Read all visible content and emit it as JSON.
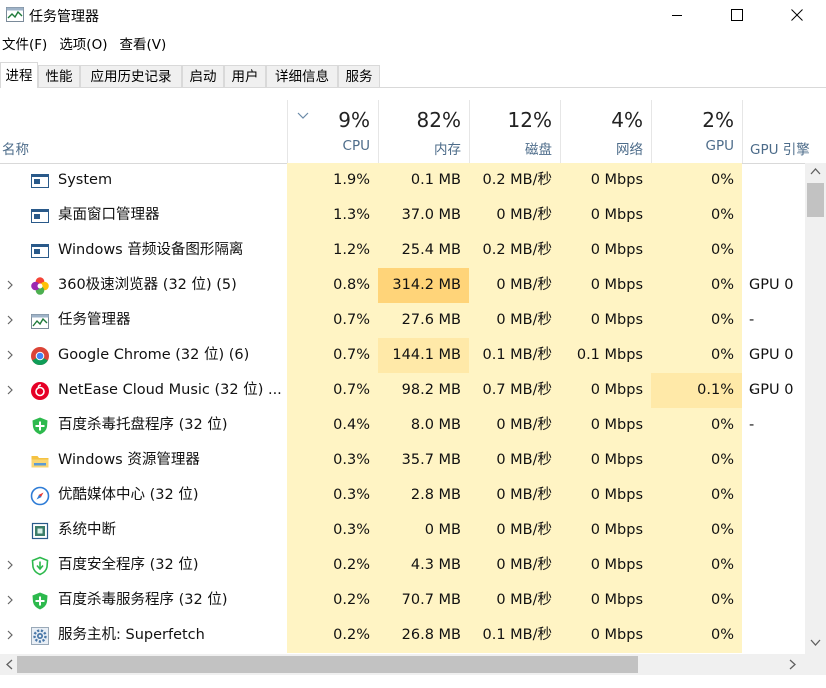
{
  "window": {
    "title": "任务管理器"
  },
  "menu": [
    "文件(F)",
    "选项(O)",
    "查看(V)"
  ],
  "tabs": [
    "进程",
    "性能",
    "应用历史记录",
    "启动",
    "用户",
    "详细信息",
    "服务"
  ],
  "columns": {
    "name_label": "名称",
    "cpu": {
      "pct": "9%",
      "label": "CPU"
    },
    "mem": {
      "pct": "82%",
      "label": "内存"
    },
    "disk": {
      "pct": "12%",
      "label": "磁盘"
    },
    "net": {
      "pct": "4%",
      "label": "网络"
    },
    "gpu": {
      "pct": "2%",
      "label": "GPU"
    },
    "engine_label": "GPU 引擎"
  },
  "colors": {
    "heat_light": "#fff4c4",
    "heat_mid": "#ffe9a8",
    "heat_hot": "#ffd479",
    "accent_text": "#4d6c8a"
  },
  "processes": [
    {
      "name": "System",
      "icon": "window-app-icon",
      "expandable": false,
      "cpu": "1.9%",
      "mem": "0.1 MB",
      "disk": "0.2 MB/秒",
      "net": "0 Mbps",
      "gpu": "0%",
      "engine": ""
    },
    {
      "name": "桌面窗口管理器",
      "icon": "window-app-icon",
      "expandable": false,
      "cpu": "1.3%",
      "mem": "37.0 MB",
      "disk": "0 MB/秒",
      "net": "0 Mbps",
      "gpu": "0%",
      "engine": ""
    },
    {
      "name": "Windows 音频设备图形隔离",
      "icon": "window-app-icon",
      "expandable": false,
      "cpu": "1.2%",
      "mem": "25.4 MB",
      "disk": "0.2 MB/秒",
      "net": "0 Mbps",
      "gpu": "0%",
      "engine": ""
    },
    {
      "name": "360极速浏览器 (32 位) (5)",
      "icon": "360-browser-icon",
      "expandable": true,
      "cpu": "0.8%",
      "mem": "314.2 MB",
      "disk": "0 MB/秒",
      "net": "0 Mbps",
      "gpu": "0%",
      "engine": "GPU 0 -"
    },
    {
      "name": "任务管理器",
      "icon": "task-manager-icon",
      "expandable": true,
      "cpu": "0.7%",
      "mem": "27.6 MB",
      "disk": "0 MB/秒",
      "net": "0 Mbps",
      "gpu": "0%",
      "engine": ""
    },
    {
      "name": "Google Chrome (32 位) (6)",
      "icon": "chrome-icon",
      "expandable": true,
      "cpu": "0.7%",
      "mem": "144.1 MB",
      "disk": "0.1 MB/秒",
      "net": "0.1 Mbps",
      "gpu": "0%",
      "engine": "GPU 0 -"
    },
    {
      "name": "NetEase Cloud Music (32 位) ...",
      "icon": "netease-music-icon",
      "expandable": true,
      "cpu": "0.7%",
      "mem": "98.2 MB",
      "disk": "0.7 MB/秒",
      "net": "0 Mbps",
      "gpu": "0.1%",
      "engine": "GPU 0 -"
    },
    {
      "name": "百度杀毒托盘程序 (32 位)",
      "icon": "shield-icon",
      "expandable": false,
      "cpu": "0.4%",
      "mem": "8.0 MB",
      "disk": "0 MB/秒",
      "net": "0 Mbps",
      "gpu": "0%",
      "engine": ""
    },
    {
      "name": "Windows 资源管理器",
      "icon": "folder-icon",
      "expandable": false,
      "cpu": "0.3%",
      "mem": "35.7 MB",
      "disk": "0 MB/秒",
      "net": "0 Mbps",
      "gpu": "0%",
      "engine": ""
    },
    {
      "name": "优酷媒体中心 (32 位)",
      "icon": "compass-icon",
      "expandable": false,
      "cpu": "0.3%",
      "mem": "2.8 MB",
      "disk": "0 MB/秒",
      "net": "0 Mbps",
      "gpu": "0%",
      "engine": ""
    },
    {
      "name": "系统中断",
      "icon": "cpu-chip-icon",
      "expandable": false,
      "cpu": "0.3%",
      "mem": "0 MB",
      "disk": "0 MB/秒",
      "net": "0 Mbps",
      "gpu": "0%",
      "engine": ""
    },
    {
      "name": "百度安全程序 (32 位)",
      "icon": "shield-download-icon",
      "expandable": true,
      "cpu": "0.2%",
      "mem": "4.3 MB",
      "disk": "0 MB/秒",
      "net": "0 Mbps",
      "gpu": "0%",
      "engine": ""
    },
    {
      "name": "百度杀毒服务程序 (32 位)",
      "icon": "shield-icon",
      "expandable": true,
      "cpu": "0.2%",
      "mem": "70.7 MB",
      "disk": "0 MB/秒",
      "net": "0 Mbps",
      "gpu": "0%",
      "engine": ""
    },
    {
      "name": "服务主机: Superfetch",
      "icon": "gear-icon",
      "expandable": true,
      "cpu": "0.2%",
      "mem": "26.8 MB",
      "disk": "0.1 MB/秒",
      "net": "0 Mbps",
      "gpu": "0%",
      "engine": ""
    }
  ]
}
